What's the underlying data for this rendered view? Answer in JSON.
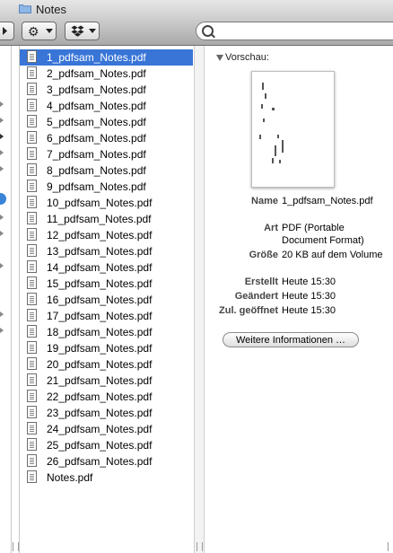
{
  "window": {
    "title": "Notes"
  },
  "toolbar": {
    "search_placeholder": ""
  },
  "files": [
    "1_pdfsam_Notes.pdf",
    "2_pdfsam_Notes.pdf",
    "3_pdfsam_Notes.pdf",
    "4_pdfsam_Notes.pdf",
    "5_pdfsam_Notes.pdf",
    "6_pdfsam_Notes.pdf",
    "7_pdfsam_Notes.pdf",
    "8_pdfsam_Notes.pdf",
    "9_pdfsam_Notes.pdf",
    "10_pdfsam_Notes.pdf",
    "11_pdfsam_Notes.pdf",
    "12_pdfsam_Notes.pdf",
    "13_pdfsam_Notes.pdf",
    "14_pdfsam_Notes.pdf",
    "15_pdfsam_Notes.pdf",
    "16_pdfsam_Notes.pdf",
    "17_pdfsam_Notes.pdf",
    "18_pdfsam_Notes.pdf",
    "19_pdfsam_Notes.pdf",
    "20_pdfsam_Notes.pdf",
    "21_pdfsam_Notes.pdf",
    "22_pdfsam_Notes.pdf",
    "23_pdfsam_Notes.pdf",
    "24_pdfsam_Notes.pdf",
    "25_pdfsam_Notes.pdf",
    "26_pdfsam_Notes.pdf",
    "Notes.pdf"
  ],
  "selected_index": 0,
  "preview": {
    "label": "Vorschau:",
    "info": [
      {
        "key": "Name",
        "value": "1_pdfsam_Notes.pdf"
      },
      {
        "key": "Art",
        "value": "PDF (Portable Document Format)"
      },
      {
        "key": "Größe",
        "value": "20 KB auf dem Volume"
      },
      {
        "key": "Erstellt",
        "value": "Heute 15:30"
      },
      {
        "key": "Geändert",
        "value": "Heute 15:30"
      },
      {
        "key": "Zul. geöffnet",
        "value": "Heute 15:30"
      }
    ],
    "more_button": "Weitere Informationen …"
  },
  "colors": {
    "selection": "#3875d7"
  }
}
